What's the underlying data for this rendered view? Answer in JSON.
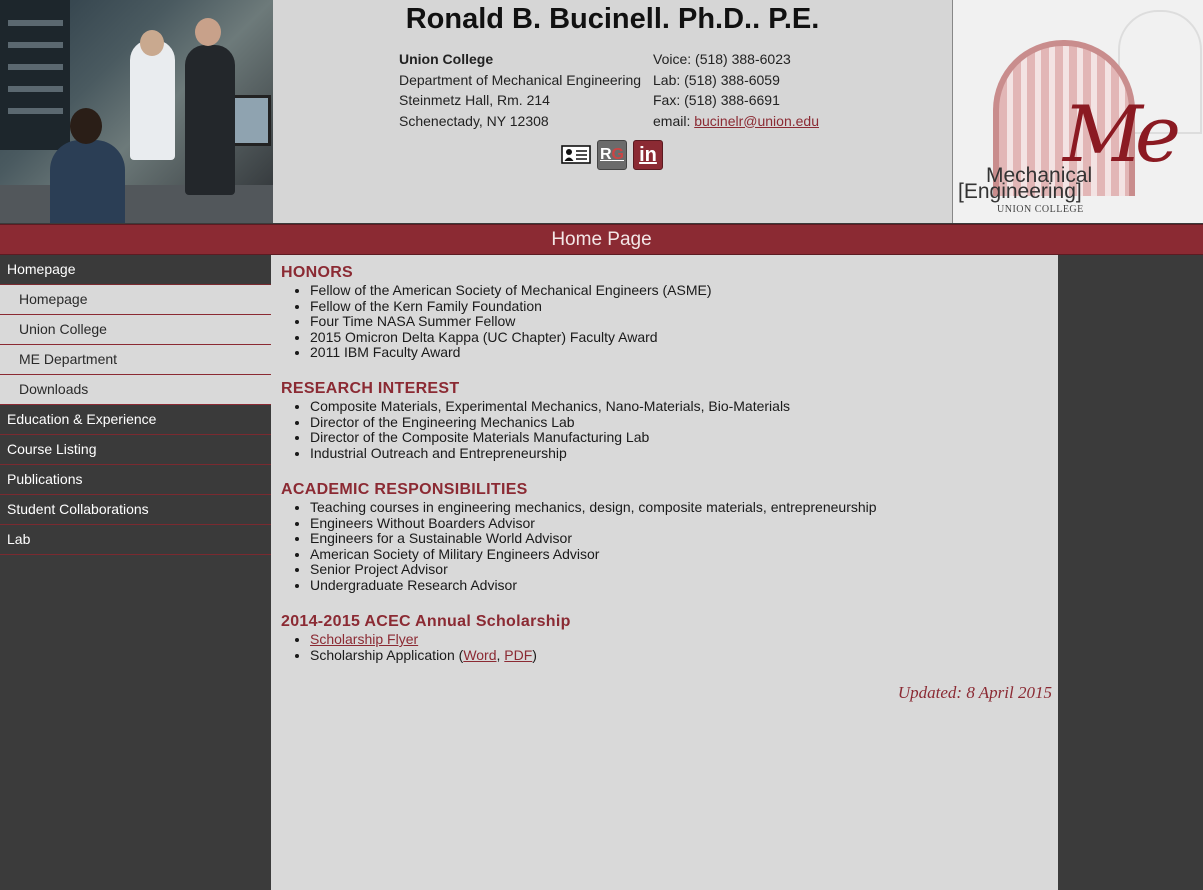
{
  "header": {
    "title": "Ronald B. Bucinell. Ph.D.. P.E.",
    "address": [
      "Union College",
      "Department of Mechanical Engineering",
      "Steinmetz Hall, Rm. 214",
      "Schenectady, NY 12308"
    ],
    "contact": {
      "voice": "Voice: (518) 388-6023",
      "lab": "Lab: (518) 388-6059",
      "fax": "Fax: (518) 388-6691",
      "email_label": "email: ",
      "email": "bucinelr@union.edu"
    },
    "social": {
      "vcard_icon": "vcard-icon",
      "rg_text": "R",
      "rg_text2": "G",
      "linkedin_text": "in"
    },
    "logo": {
      "me_text": "Me",
      "mech_line1": "Mechanical",
      "mech_line2": "[Engineering]",
      "college": "UNION COLLEGE"
    }
  },
  "page_bar": {
    "title": "Home Page"
  },
  "sidebar": {
    "items": [
      {
        "label": "Homepage",
        "level": "top"
      },
      {
        "label": "Homepage",
        "level": "sub"
      },
      {
        "label": "Union College",
        "level": "sub"
      },
      {
        "label": "ME Department",
        "level": "sub"
      },
      {
        "label": "Downloads",
        "level": "sub"
      },
      {
        "label": "Education & Experience",
        "level": "top"
      },
      {
        "label": "Course Listing",
        "level": "top"
      },
      {
        "label": "Publications",
        "level": "top"
      },
      {
        "label": "Student Collaborations",
        "level": "top"
      },
      {
        "label": "Lab",
        "level": "top"
      }
    ]
  },
  "main": {
    "honors": {
      "heading": "HONORS",
      "items": [
        "Fellow of the American Society of Mechanical Engineers (ASME)",
        "Fellow of the Kern Family Foundation",
        "Four Time NASA Summer Fellow",
        "2015 Omicron Delta Kappa (UC Chapter) Faculty Award",
        "2011 IBM Faculty Award"
      ]
    },
    "research": {
      "heading": "RESEARCH INTEREST",
      "items": [
        "Composite Materials, Experimental Mechanics, Nano-Materials, Bio-Materials",
        "Director of the Engineering Mechanics Lab",
        "Director of the Composite Materials Manufacturing Lab",
        "Industrial Outreach and Entrepreneurship"
      ]
    },
    "academic": {
      "heading": "ACADEMIC RESPONSIBILITIES",
      "items": [
        "Teaching courses in engineering mechanics, design, composite materials, entrepreneurship",
        "Engineers Without Boarders Advisor",
        "Engineers for a Sustainable World Advisor",
        "American Society of Military Engineers Advisor",
        "Senior Project Advisor",
        "Undergraduate Research Advisor"
      ]
    },
    "scholarship": {
      "heading": "2014-2015 ACEC Annual Scholarship",
      "flyer_link": "Scholarship Flyer",
      "app_prefix": "Scholarship Application (",
      "word_link": "Word",
      "sep": ", ",
      "pdf_link": "PDF",
      "app_suffix": ")"
    },
    "updated": "Updated: 8 April 2015"
  },
  "colors": {
    "accent": "#8b2a33",
    "sidebar_dark": "#3a3a3a",
    "content_bg": "#d9d9d9"
  }
}
